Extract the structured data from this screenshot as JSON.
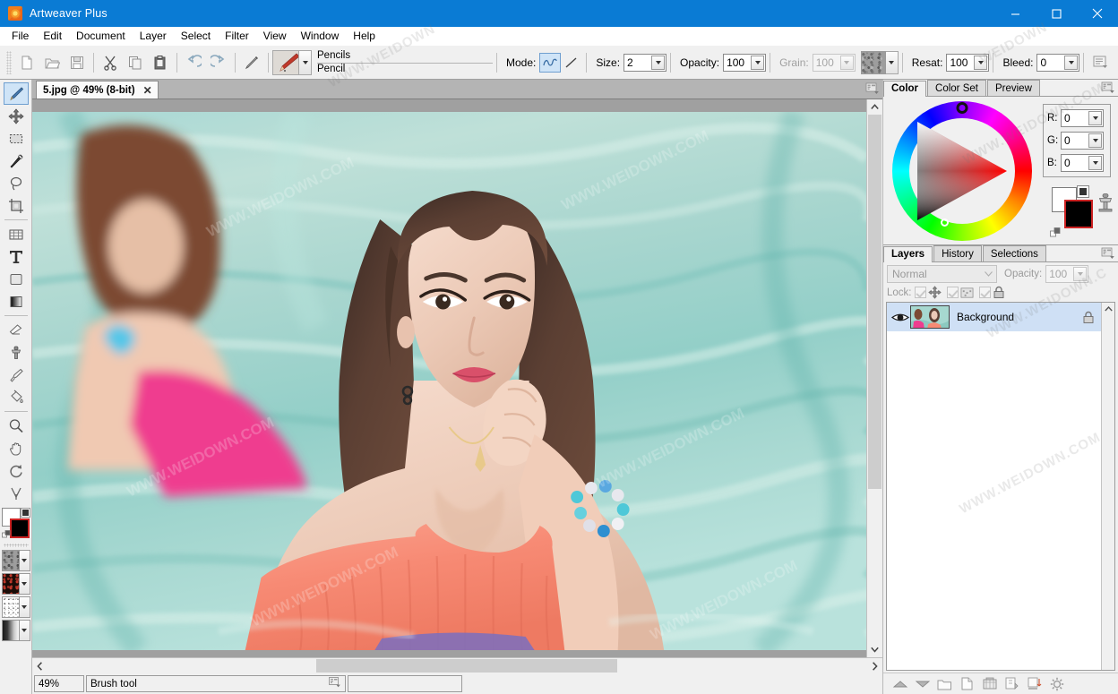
{
  "window": {
    "title": "Artweaver Plus",
    "app_icon": "flower-icon",
    "minimize": "minimize-icon",
    "maximize": "maximize-icon",
    "close": "close-icon",
    "titlebar_color": "#0a7bd4"
  },
  "menubar": {
    "items": [
      "File",
      "Edit",
      "Document",
      "Layer",
      "Select",
      "Filter",
      "View",
      "Window",
      "Help"
    ]
  },
  "toolbar": {
    "buttons": [
      {
        "name": "new-document-button",
        "icon": "page-icon"
      },
      {
        "name": "open-document-button",
        "icon": "folder-open-icon"
      },
      {
        "name": "save-document-button",
        "icon": "floppy-disk-icon"
      },
      {
        "name": "cut-button",
        "icon": "scissors-icon"
      },
      {
        "name": "copy-button",
        "icon": "copy-icon"
      },
      {
        "name": "paste-button",
        "icon": "clipboard-icon"
      },
      {
        "name": "undo-button",
        "icon": "undo-arrow-icon"
      },
      {
        "name": "redo-button",
        "icon": "redo-arrow-icon"
      },
      {
        "name": "brush-tool-button",
        "icon": "pencil-icon"
      }
    ],
    "brush_category": "Pencils",
    "brush_variant": "Pencil",
    "mode_label": "Mode:",
    "size_label": "Size:",
    "size_value": "2",
    "opacity_label": "Opacity:",
    "opacity_value": "100",
    "grain_label": "Grain:",
    "grain_value": "100",
    "resat_label": "Resat:",
    "resat_value": "100",
    "bleed_label": "Bleed:",
    "bleed_value": "0",
    "options_menu": "brush-options-icon"
  },
  "tools": [
    {
      "name": "tool-brush",
      "icon": "paintbrush-icon",
      "selected": true
    },
    {
      "name": "tool-move",
      "icon": "move-arrows-icon",
      "selected": false
    },
    {
      "name": "tool-rectangular-marquee",
      "icon": "marquee-select-icon",
      "selected": false
    },
    {
      "name": "tool-magic-wand",
      "icon": "magic-wand-icon",
      "selected": false
    },
    {
      "name": "tool-lasso",
      "icon": "lasso-icon",
      "selected": false
    },
    {
      "name": "tool-crop",
      "icon": "crop-icon",
      "selected": false
    },
    {
      "name": "tool-perspective",
      "icon": "perspective-grid-icon",
      "selected": false
    },
    {
      "name": "tool-text",
      "icon": "text-t-icon",
      "selected": false
    },
    {
      "name": "tool-shape",
      "icon": "rounded-square-icon",
      "selected": false
    },
    {
      "name": "tool-gradient",
      "icon": "gradient-icon",
      "selected": false
    },
    {
      "name": "tool-eraser",
      "icon": "eraser-icon",
      "selected": false
    },
    {
      "name": "tool-clone-stamp",
      "icon": "clone-stamp-icon",
      "selected": false
    },
    {
      "name": "tool-eyedropper",
      "icon": "eyedropper-icon",
      "selected": false
    },
    {
      "name": "tool-paint-bucket",
      "icon": "paint-bucket-icon",
      "selected": false
    },
    {
      "name": "tool-zoom",
      "icon": "magnifier-icon",
      "selected": false
    },
    {
      "name": "tool-hand",
      "icon": "hand-icon",
      "selected": false
    },
    {
      "name": "tool-rotate-canvas",
      "icon": "rotate-arrow-icon",
      "selected": false
    },
    {
      "name": "tool-smudge",
      "icon": "smudge-icon",
      "selected": false
    }
  ],
  "color_swatches": {
    "foreground": "#ffffff",
    "background": "#000000",
    "selected_swatch": "background",
    "reset_icon": "reset-colors-icon",
    "swap_icon": "swap-colors-icon"
  },
  "material_pickers": [
    {
      "name": "grain-texture-picker",
      "icon": "texture-swatch"
    },
    {
      "name": "pattern-picker",
      "icon": "pattern-swatch"
    },
    {
      "name": "nozzle-picker",
      "icon": "nozzle-swatch"
    },
    {
      "name": "gradient-picker",
      "icon": "gradient-swatch"
    }
  ],
  "document": {
    "tab_title": "5.jpg @ 49% (8-bit)",
    "tab_close": "close-icon",
    "tab_menu": "document-menu-icon"
  },
  "statusbar": {
    "zoom": "49%",
    "tool": "Brush tool",
    "tool_menu_icon": "status-menu-icon",
    "extra": ""
  },
  "color_panel": {
    "tabs": [
      {
        "label": "Color",
        "active": true
      },
      {
        "label": "Color Set",
        "active": false
      },
      {
        "label": "Preview",
        "active": false
      }
    ],
    "menu_icon": "panel-menu-icon",
    "wheel_icon": "color-wheel",
    "channels": [
      {
        "label": "R:",
        "value": "0"
      },
      {
        "label": "G:",
        "value": "0"
      },
      {
        "label": "B:",
        "value": "0"
      }
    ]
  },
  "layers_panel": {
    "tabs": [
      {
        "label": "Layers",
        "active": true
      },
      {
        "label": "History",
        "active": false
      },
      {
        "label": "Selections",
        "active": false
      }
    ],
    "menu_icon": "panel-menu-icon",
    "blend_mode": "Normal",
    "opacity_label": "Opacity:",
    "opacity_value": "100",
    "lock_label": "Lock:",
    "lock_items": [
      {
        "name": "lock-transparency-checkbox",
        "icon": "move-arrows-icon",
        "checked": true
      },
      {
        "name": "lock-pixels-checkbox",
        "icon": "pixels-icon",
        "checked": true
      },
      {
        "name": "lock-position-checkbox",
        "icon": "padlock-icon",
        "checked": true
      }
    ],
    "layers": [
      {
        "name": "Background",
        "visible": true,
        "locked": true,
        "selected": true
      }
    ],
    "buttons": [
      {
        "name": "move-layer-up-button",
        "icon": "triangle-up-icon"
      },
      {
        "name": "move-layer-down-button",
        "icon": "triangle-down-icon"
      },
      {
        "name": "new-layer-group-button",
        "icon": "folder-icon"
      },
      {
        "name": "new-layer-button",
        "icon": "page-icon"
      },
      {
        "name": "layer-mask-button",
        "icon": "mask-icon"
      },
      {
        "name": "duplicate-layer-button",
        "icon": "duplicate-icon"
      },
      {
        "name": "merge-layer-button",
        "icon": "merge-down-icon"
      },
      {
        "name": "layer-properties-button",
        "icon": "gear-icon"
      }
    ]
  },
  "canvas": {
    "image_name": "5.jpg",
    "zoom_percent": "49%",
    "vertical_scrollbar": "canvas-vertical-scrollbar",
    "horizontal_scrollbar": "canvas-horizontal-scrollbar"
  },
  "watermarks": [
    "WWW.WEIDOWN.COM",
    "WEIDOWN.COM",
    "WWW.WEIDOWN"
  ]
}
